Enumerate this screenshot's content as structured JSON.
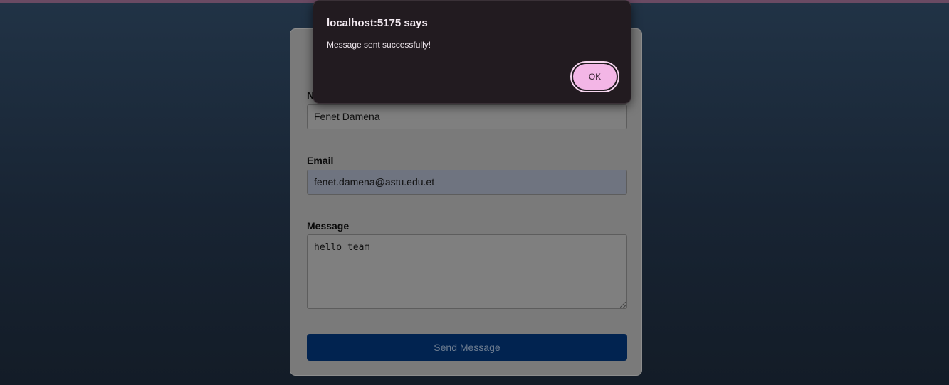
{
  "dialog": {
    "title": "localhost:5175 says",
    "message": "Message sent successfully!",
    "ok_label": "OK"
  },
  "form": {
    "name_label": "N",
    "name_value": "Fenet Damena",
    "email_label": "Email",
    "email_value": "fenet.damena@astu.edu.et",
    "message_label": "Message",
    "message_value": "hello team",
    "submit_label": "Send Message"
  },
  "colors": {
    "dialog_background": "#221b20",
    "ok_button": "#f3b6e6",
    "submit_button": "#012350",
    "page_background_top": "#213346",
    "page_background_bottom": "#131c27"
  }
}
